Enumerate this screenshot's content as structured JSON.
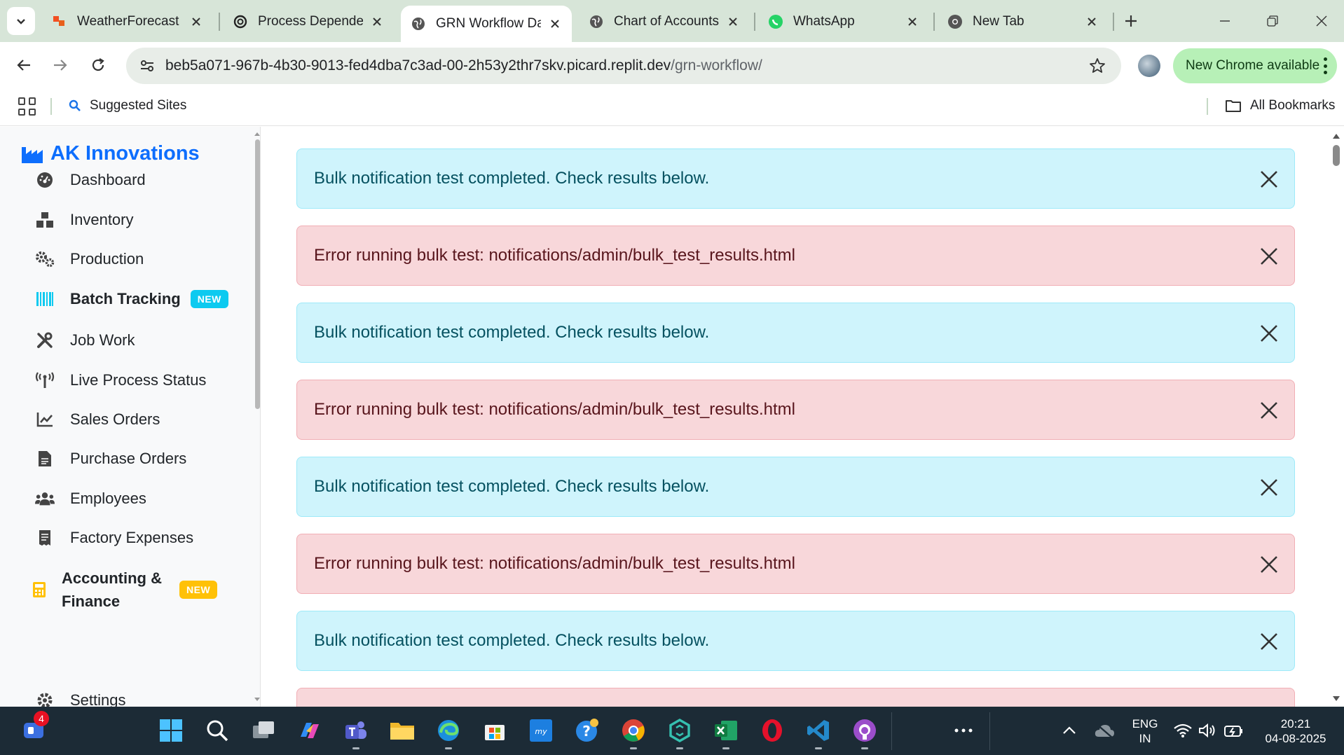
{
  "browser": {
    "tabs": [
      {
        "title": "WeatherForecast -",
        "icon": "weather-app-icon",
        "active": false
      },
      {
        "title": "Process Dependen",
        "icon": "openai-icon",
        "active": false
      },
      {
        "title": "GRN Workflow Da",
        "icon": "globe-icon",
        "active": true
      },
      {
        "title": "Chart of Accounts",
        "icon": "globe-icon",
        "active": false
      },
      {
        "title": "WhatsApp",
        "icon": "whatsapp-icon",
        "active": false
      },
      {
        "title": "New Tab",
        "icon": "chrome-icon",
        "active": false
      }
    ],
    "url_host": "beb5a071-967b-4b30-9013-fed4dba7c3ad-00-2h53y2thr7skv.picard.replit.dev",
    "url_path": "/grn-workflow/",
    "update_label": "New Chrome available",
    "bookmarks": {
      "suggested": "Suggested Sites",
      "all": "All Bookmarks"
    }
  },
  "sidebar": {
    "brand": "AK Innovations",
    "items": [
      {
        "label": "Dashboard",
        "icon": "dashboard-gauge-icon"
      },
      {
        "label": "Inventory",
        "icon": "boxes-icon"
      },
      {
        "label": "Production",
        "icon": "cogs-icon"
      },
      {
        "label": "Batch Tracking",
        "icon": "barcode-icon",
        "badge": "NEW",
        "bold": true
      },
      {
        "label": "Job Work",
        "icon": "tools-icon"
      },
      {
        "label": "Live Process Status",
        "icon": "broadcast-tower-icon"
      },
      {
        "label": "Sales Orders",
        "icon": "line-chart-icon"
      },
      {
        "label": "Purchase Orders",
        "icon": "file-invoice-icon"
      },
      {
        "label": "Employees",
        "icon": "users-icon"
      },
      {
        "label": "Factory Expenses",
        "icon": "receipt-icon"
      },
      {
        "label_line1": "Accounting &",
        "label_line2": "Finance",
        "icon": "calculator-icon",
        "badge": "NEW",
        "bold": true
      },
      {
        "label": "Settings",
        "icon": "gear-icon"
      }
    ]
  },
  "alerts": [
    {
      "type": "info",
      "message": "Bulk notification test completed. Check results below."
    },
    {
      "type": "danger",
      "message": "Error running bulk test: notifications/admin/bulk_test_results.html"
    },
    {
      "type": "info",
      "message": "Bulk notification test completed. Check results below."
    },
    {
      "type": "danger",
      "message": "Error running bulk test: notifications/admin/bulk_test_results.html"
    },
    {
      "type": "info",
      "message": "Bulk notification test completed. Check results below."
    },
    {
      "type": "danger",
      "message": "Error running bulk test: notifications/admin/bulk_test_results.html"
    },
    {
      "type": "info",
      "message": "Bulk notification test completed. Check results below."
    }
  ],
  "taskbar": {
    "notification_count": "4",
    "language_line1": "ENG",
    "language_line2": "IN",
    "time": "20:21",
    "date": "04-08-2025"
  },
  "colors": {
    "brand": "#0d6efd",
    "info_bg": "#cff4fc",
    "danger_bg": "#f8d7da",
    "badge_new_blue": "#0dcaf0",
    "badge_new_yellow": "#ffc107"
  }
}
